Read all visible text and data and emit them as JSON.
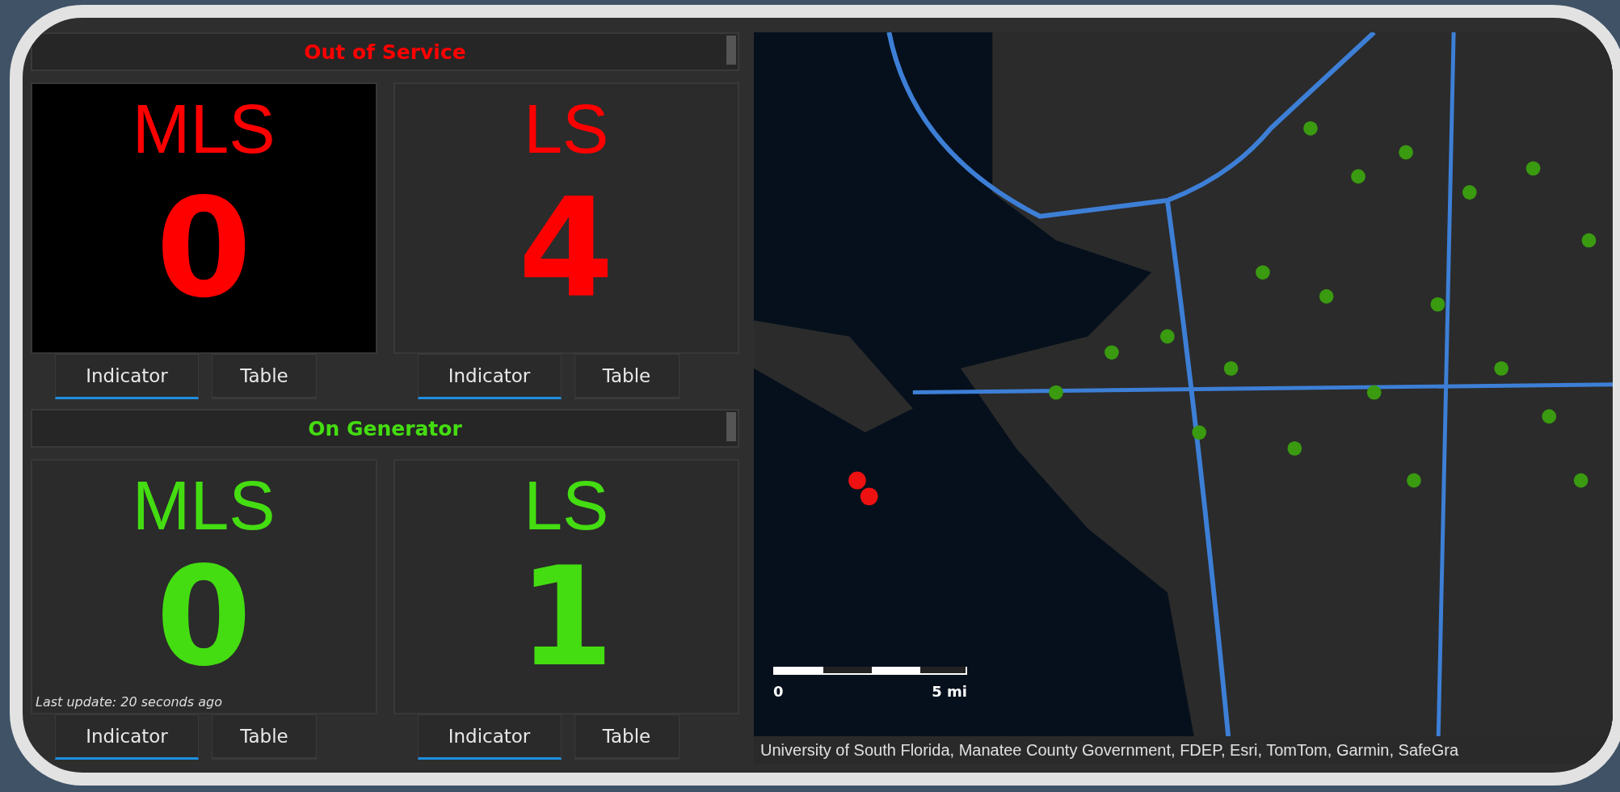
{
  "sections": [
    {
      "title": "Out of Service",
      "color": "#ff0000",
      "cards": [
        {
          "label": "MLS",
          "value": "0",
          "highlighted": true,
          "tabs": [
            {
              "label": "Indicator",
              "selected": true
            },
            {
              "label": "Table",
              "selected": false
            }
          ]
        },
        {
          "label": "LS",
          "value": "4",
          "highlighted": false,
          "tabs": [
            {
              "label": "Indicator",
              "selected": true
            },
            {
              "label": "Table",
              "selected": false
            }
          ]
        }
      ]
    },
    {
      "title": "On Generator",
      "color": "#44dd11",
      "cards": [
        {
          "label": "MLS",
          "value": "0",
          "highlighted": false,
          "footnote": "Last update: 20 seconds ago",
          "tabs": [
            {
              "label": "Indicator",
              "selected": true
            },
            {
              "label": "Table",
              "selected": false
            }
          ]
        },
        {
          "label": "LS",
          "value": "1",
          "highlighted": false,
          "tabs": [
            {
              "label": "Indicator",
              "selected": true
            },
            {
              "label": "Table",
              "selected": false
            }
          ]
        }
      ]
    }
  ],
  "map": {
    "kind": "picture",
    "scale_start": "0",
    "scale_end": "5 mi",
    "attribution": "University of South Florida, Manatee County Government, FDEP, Esri, TomTom, Garmin, SafeGra"
  }
}
